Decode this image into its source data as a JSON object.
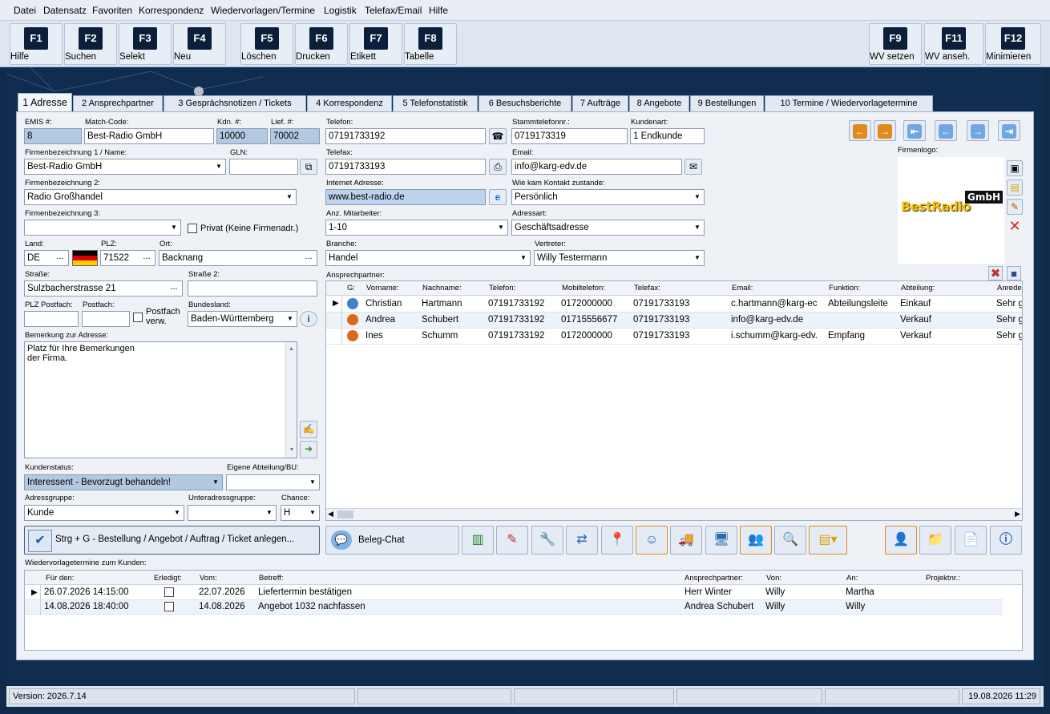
{
  "menu": [
    "Datei",
    "Datensatz",
    "Favoriten",
    "Korrespondenz",
    "Wiedervorlagen/Termine",
    "Logistik",
    "Telefax/Email",
    "Hilfe"
  ],
  "fkeys": [
    {
      "key": "F1",
      "label": "Hilfe"
    },
    {
      "key": "F2",
      "label": "Suchen"
    },
    {
      "key": "F3",
      "label": "Selekt"
    },
    {
      "key": "F4",
      "label": "Neu"
    },
    {
      "key": "F5",
      "label": "Löschen"
    },
    {
      "key": "F6",
      "label": "Drucken"
    },
    {
      "key": "F7",
      "label": "Etikett"
    },
    {
      "key": "F8",
      "label": "Tabelle"
    },
    {
      "key": "F9",
      "label": "WV setzen"
    },
    {
      "key": "F11",
      "label": "WV anseh."
    },
    {
      "key": "F12",
      "label": "Minimieren"
    }
  ],
  "tabs": [
    "1 Adresse",
    "2 Ansprechpartner",
    "3 Gesprächsnotizen / Tickets",
    "4 Korrespondenz",
    "5 Telefonstatistik",
    "6 Besuchsberichte",
    "7 Aufträge",
    "8 Angebote",
    "9 Bestellungen",
    "10 Termine / Wiedervorlagetermine"
  ],
  "form": {
    "emis_label": "EMIS #:",
    "emis": "8",
    "match_label": "Match-Code:",
    "match": "Best-Radio GmbH",
    "kdn_label": "Kdn. #:",
    "kdn": "10000",
    "lief_label": "Lief. #:",
    "lief": "70002",
    "firma1_label": "Firmenbezeichnung 1 / Name:",
    "firma1": "Best-Radio GmbH",
    "gln_label": "GLN:",
    "gln": "",
    "firma2_label": "Firmenbezeichnung 2:",
    "firma2": "Radio Großhandel",
    "firma3_label": "Firmenbezeichnung 3:",
    "firma3": "",
    "privat_label": "Privat (Keine Firmenadr.)",
    "land_label": "Land:",
    "land": "DE",
    "plz_label": "PLZ:",
    "plz": "71522",
    "ort_label": "Ort:",
    "ort": "Backnang",
    "strasse_label": "Straße:",
    "strasse": "Sulzbacherstrasse 21",
    "strasse2_label": "Straße 2:",
    "strasse2": "",
    "plzpf_label": "PLZ Postfach:",
    "postfach_label": "Postfach:",
    "postfach_verw_label": "Postfach verw.",
    "bundesland_label": "Bundesland:",
    "bundesland": "Baden-Württemberg",
    "bemerkung_label": "Bemerkung zur Adresse:",
    "bemerkung_line1": "Platz für Ihre Bemerkungen",
    "bemerkung_line2": "der Firma.",
    "kundenstatus_label": "Kundenstatus:",
    "kundenstatus": "Interessent - Bevorzugt behandeln!",
    "eigene_label": "Eigene Abteilung/BU:",
    "eigene": "",
    "adressgruppe_label": "Adressgruppe:",
    "adressgruppe": "Kunde",
    "unteradr_label": "Unteradressgruppe:",
    "unteradr": "",
    "chance_label": "Chance:",
    "chance": "H",
    "telefon_label": "Telefon:",
    "telefon": "07191733192",
    "stamm_label": "Stammtelefonnr.:",
    "stamm": "0719173319",
    "kundenart_label": "Kundenart:",
    "kundenart": "1 Endkunde",
    "telefax_label": "Telefax:",
    "telefax": "07191733193",
    "email_label": "Email:",
    "email": "info@karg-edv.de",
    "internet_label": "Internet Adresse:",
    "internet": "www.best-radio.de",
    "kontakt_label": "Wie kam Kontakt zustande:",
    "kontakt": "Persönlich",
    "mitarbeiter_label": "Anz. Mitarbeiter:",
    "mitarbeiter": "1-10",
    "adressart_label": "Adressart:",
    "adressart": "Geschäftsadresse",
    "branche_label": "Branche:",
    "branche": "Handel",
    "vertreter_label": "Vertreter:",
    "vertreter": "Willy Testermann",
    "logo_label": "Firmenlogo:",
    "logo_text1": "BestRadio",
    "logo_text2": "GmbH"
  },
  "contacts": {
    "label": "Ansprechpartner:",
    "headers": [
      "G:",
      "Vorname:",
      "Nachname:",
      "Telefon:",
      "Mobiltelefon:",
      "Telefax:",
      "Email:",
      "Funktion:",
      "Abteilung:",
      "Anrede"
    ],
    "rows": [
      {
        "vorname": "Christian",
        "nachname": "Hartmann",
        "telefon": "07191733192",
        "mobil": "0172000000",
        "fax": "07191733193",
        "email": "c.hartmann@karg-ec",
        "funktion": "Abteilungsleite",
        "abteilung": "Einkauf",
        "anrede": "Sehr g"
      },
      {
        "vorname": "Andrea",
        "nachname": "Schubert",
        "telefon": "07191733192",
        "mobil": "01715556677",
        "fax": "07191733193",
        "email": "info@karg-edv.de",
        "funktion": "",
        "abteilung": "Verkauf",
        "anrede": "Sehr g"
      },
      {
        "vorname": "Ines",
        "nachname": "Schumm",
        "telefon": "07191733192",
        "mobil": "0172000000",
        "fax": "07191733193",
        "email": "i.schumm@karg-edv.",
        "funktion": "Empfang",
        "abteilung": "Verkauf",
        "anrede": "Sehr g"
      }
    ]
  },
  "actions": {
    "order_button": "Strg + G - Bestellung / Angebot / Auftrag / Ticket anlegen...",
    "chat_button": "Beleg-Chat"
  },
  "followups": {
    "label": "Wiedervorlagetermine zum Kunden:",
    "headers": [
      "Für den:",
      "Erledigt:",
      "Vom:",
      "Betreff:",
      "Ansprechpartner:",
      "Von:",
      "An:",
      "Projektnr.:"
    ],
    "rows": [
      {
        "fuer": "26.07.2026 14:15:00",
        "vom": "22.07.2026",
        "betreff": "Liefertermin bestätigen",
        "ap": "Herr Winter",
        "von": "Willy",
        "an": "Martha",
        "projekt": ""
      },
      {
        "fuer": "14.08.2026 18:40:00",
        "vom": "14.08.2026",
        "betreff": "Angebot 1032 nachfassen",
        "ap": "Andrea Schubert",
        "von": "Willy",
        "an": "Willy",
        "projekt": ""
      }
    ]
  },
  "status": {
    "version": "Version: 2026.7.14",
    "datetime": "19.08.2026 11:29"
  },
  "colors": {
    "accent": "#e08a1e",
    "navy": "#0f2a4a",
    "fieldBlue": "#b3c9e2"
  }
}
